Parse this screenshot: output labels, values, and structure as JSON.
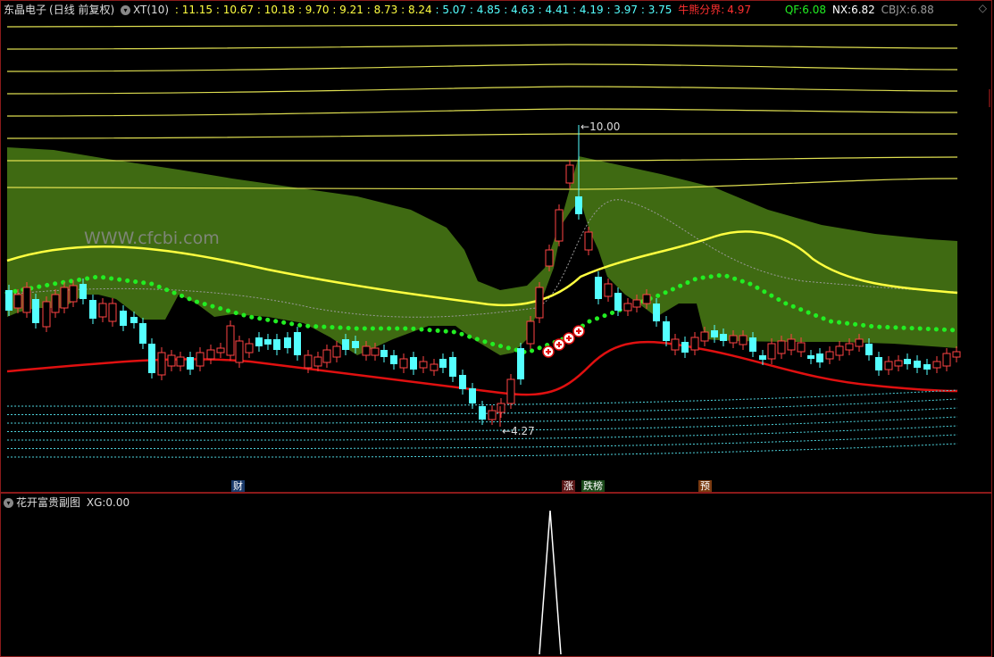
{
  "header": {
    "title": "东晶电子",
    "period": "(日线 前复权)",
    "indicator": "XT(10)",
    "levels": [
      "11.15",
      "10.67",
      "10.18",
      "9.70",
      "9.21",
      "8.73",
      "8.24",
      "5.07",
      "4.85",
      "4.63",
      "4.41",
      "4.19",
      "3.97",
      "3.75"
    ],
    "bull_bear_label": "牛熊分界:",
    "bull_bear_value": "4.97",
    "qf_label": "QF:",
    "qf_value": "6.08",
    "nx_label": "NX:",
    "nx_value": "6.82",
    "cbjx_label": "CBJX:",
    "cbjx_value": "6.88"
  },
  "watermark": "WWW.cfcbi.com",
  "annotations": {
    "high": "10.00",
    "low": "4.27"
  },
  "tags": {
    "cai": "财",
    "zhang": "涨",
    "dieting": "跌榜",
    "yu": "预"
  },
  "sub_header": {
    "title": "花开富贵副图",
    "xg_label": "XG:",
    "xg_value": "0.00"
  },
  "colors": {
    "up": "#ff4444",
    "down": "#54ffff",
    "band": "#3f6a12",
    "yellow": "#ffff40",
    "red_line": "#e01010",
    "green_dots": "#22ee22",
    "frame": "#8b1a1a"
  },
  "chart_data": {
    "type": "candlestick",
    "price_range": [
      3.6,
      11.6
    ],
    "high_point": 10.0,
    "low_point": 4.27,
    "xg_spike_value": 1,
    "xg_current": 0.0
  }
}
